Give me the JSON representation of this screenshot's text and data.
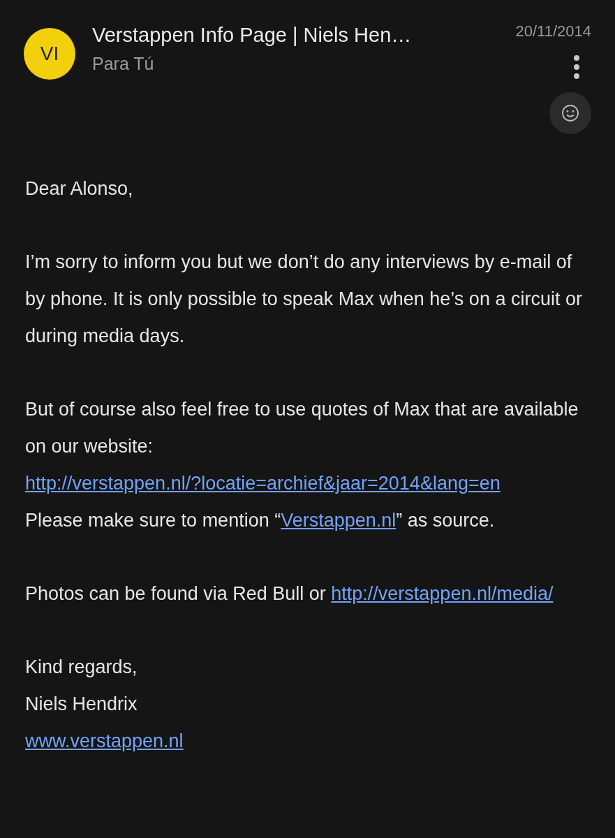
{
  "header": {
    "avatar": "VI",
    "sender": "Verstappen Info Page | Niels Hen…",
    "recipient": "Para Tú",
    "date": "20/11/2014"
  },
  "body": [
    {
      "lines": [
        [
          {
            "kind": "text",
            "text": "Dear Alonso,"
          }
        ]
      ]
    },
    {
      "lines": [
        [
          {
            "kind": "text",
            "text": "I’m sorry to inform you but we don’t do any interviews by e-mail of by phone. It is only possible to speak Max when he’s on a circuit or during media days."
          }
        ]
      ]
    },
    {
      "lines": [
        [
          {
            "kind": "text",
            "text": "But of course also feel free to use quotes of Max that are available on our website: "
          },
          {
            "kind": "link",
            "text": "http://verstappen.nl/?locatie=archief&jaar=2014&lang=en"
          }
        ],
        [
          {
            "kind": "text",
            "text": "Please make sure to mention “"
          },
          {
            "kind": "link",
            "text": "Verstappen.nl"
          },
          {
            "kind": "text",
            "text": "” as source."
          }
        ]
      ]
    },
    {
      "lines": [
        [
          {
            "kind": "text",
            "text": "Photos can be found via Red Bull or "
          },
          {
            "kind": "link",
            "text": "http://verstappen.nl/media/"
          }
        ]
      ]
    },
    {
      "lines": [
        [
          {
            "kind": "text",
            "text": "Kind regards,"
          }
        ],
        [
          {
            "kind": "text",
            "text": "Niels Hendrix"
          }
        ],
        [
          {
            "kind": "link",
            "text": "www.verstappen.nl"
          }
        ]
      ]
    }
  ]
}
